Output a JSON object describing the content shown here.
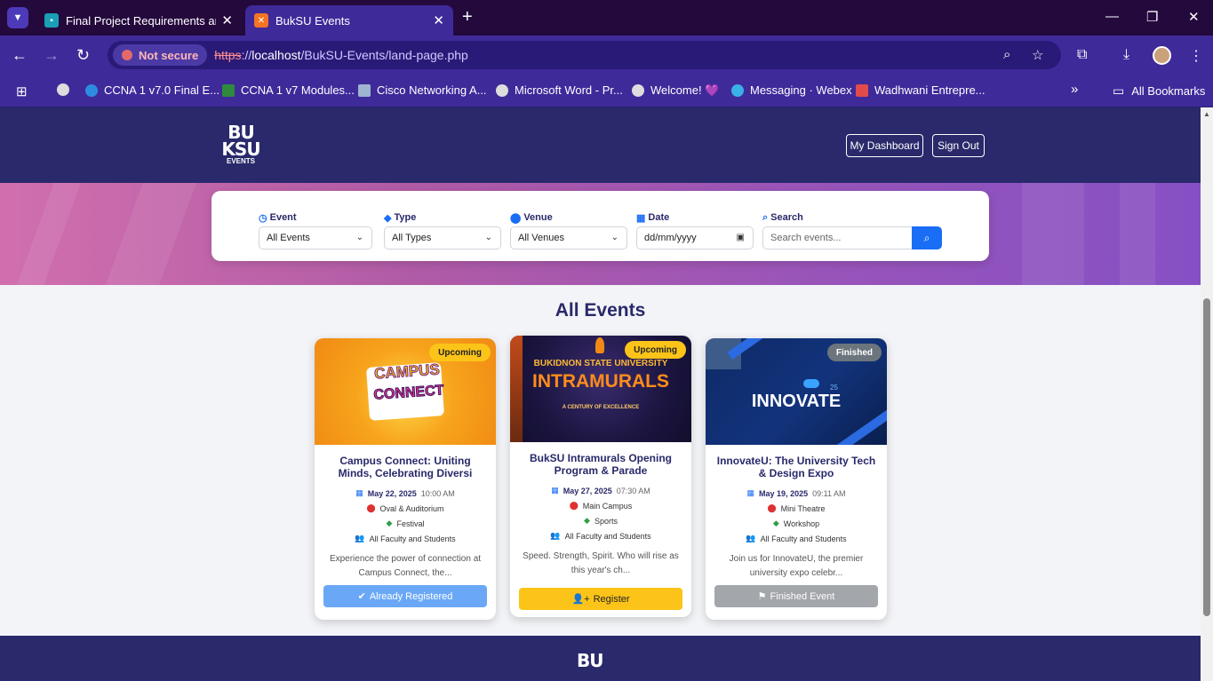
{
  "browser": {
    "tabs": [
      {
        "title": "Final Project Requirements and",
        "close": "✕"
      },
      {
        "title": "BukSU Events",
        "close": "✕"
      }
    ],
    "new_tab": "+",
    "security_label": "Not secure",
    "url_scheme": "https",
    "url_sep": "://",
    "url_host": "localhost",
    "url_path": "/BukSU-Events/land-page.php",
    "bookmarks": [
      {
        "label": "CCNA 1 v7.0 Final E..."
      },
      {
        "label": "CCNA 1 v7 Modules..."
      },
      {
        "label": "Cisco Networking A..."
      },
      {
        "label": "Microsoft Word - Pr..."
      },
      {
        "label": "Welcome! 💜"
      },
      {
        "label": "Messaging · Webex"
      },
      {
        "label": "Wadhwani Entrepre..."
      }
    ],
    "bookmarks_more": "»",
    "all_bookmarks": "All Bookmarks"
  },
  "header": {
    "logo_line1": "BU",
    "logo_line2": "KSU",
    "logo_line3": "EVENTS",
    "dashboard_label": "My Dashboard",
    "signout_label": "Sign Out"
  },
  "filters": {
    "event": {
      "label": "Event",
      "value": "All Events"
    },
    "type": {
      "label": "Type",
      "value": "All Types"
    },
    "venue": {
      "label": "Venue",
      "value": "All Venues"
    },
    "date": {
      "label": "Date",
      "value": "dd/mm/yyyy"
    },
    "search": {
      "label": "Search",
      "placeholder": "Search events..."
    }
  },
  "section_title": "All Events",
  "events": [
    {
      "status": "Upcoming",
      "image_text_1": "CAMPUS",
      "image_text_2": "CONNECT",
      "title": "Campus Connect: Uniting Minds, Celebrating Diversi",
      "date": "May 22, 2025",
      "time": "10:00 AM",
      "venue": "Oval & Auditorium",
      "type": "Festival",
      "audience": "All Faculty and Students",
      "description": "Experience the power of connection at Campus Connect, the...",
      "action": "Already Registered"
    },
    {
      "status": "Upcoming",
      "image_text_1": "BUKIDNON STATE UNIVERSITY",
      "image_text_2": "INTRAMURALS",
      "image_text_3": "A CENTURY OF EXCELLENCE",
      "title": "BukSU Intramurals Opening Program & Parade",
      "date": "May 27, 2025",
      "time": "07:30 AM",
      "venue": "Main Campus",
      "type": "Sports",
      "audience": "All Faculty and Students",
      "description": "Speed. Strength, Spirit.  Who will rise as this year's ch...",
      "action": "Register"
    },
    {
      "status": "Finished",
      "image_text_1": "INNOVATE",
      "image_text_2": "25",
      "title": "InnovateU: The University Tech & Design Expo",
      "date": "May 19, 2025",
      "time": "09:11 AM",
      "venue": "Mini Theatre",
      "type": "Workshop",
      "audience": "All Faculty and Students",
      "description": "Join us for InnovateU, the premier university expo celebr...",
      "action": "Finished Event"
    }
  ],
  "colors": {
    "navy": "#29296b",
    "accent": "#1a6ef5",
    "upcoming": "#fcc419",
    "finished": "#6c757d",
    "registered": "#6aa8f7",
    "register": "#fcc419",
    "finished_btn": "#a3a6ab"
  },
  "footer": {
    "logo": "BU"
  }
}
